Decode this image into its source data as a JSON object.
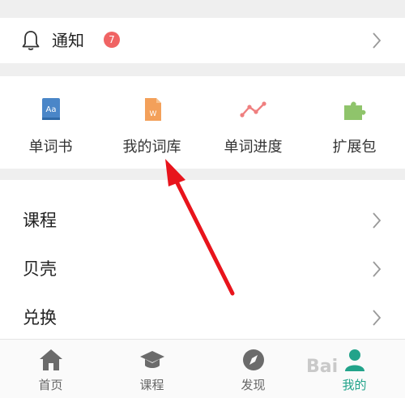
{
  "notifications": {
    "label": "通知",
    "badge": "7"
  },
  "tools": [
    {
      "label": "单词书",
      "icon": "wordbook-icon"
    },
    {
      "label": "我的词库",
      "icon": "my-vocab-icon"
    },
    {
      "label": "单词进度",
      "icon": "progress-icon"
    },
    {
      "label": "扩展包",
      "icon": "puzzle-icon"
    }
  ],
  "menu": [
    {
      "label": "课程"
    },
    {
      "label": "贝壳"
    },
    {
      "label": "兑换"
    }
  ],
  "tabbar": [
    {
      "label": "首页",
      "icon": "home-icon"
    },
    {
      "label": "课程",
      "icon": "graduation-cap-icon"
    },
    {
      "label": "发现",
      "icon": "compass-icon"
    },
    {
      "label": "我的",
      "icon": "user-icon",
      "active": true
    }
  ],
  "watermark": "Bai",
  "colors": {
    "accent": "#22a38a",
    "badge": "#f06464",
    "annotation_arrow": "#e8141c"
  }
}
